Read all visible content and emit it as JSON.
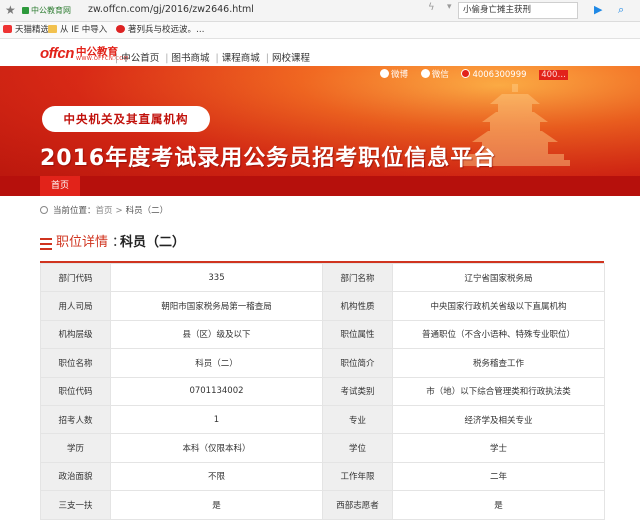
{
  "browser": {
    "site_tag": "中公教育网",
    "url": "zw.offcn.com/gj/2016/zw2646.html",
    "search_text": "小偷身亡摊主获刑"
  },
  "bookmarks": [
    {
      "label": "天猫精选",
      "icon": "tmall-icon"
    },
    {
      "label": "从 IE 中导入",
      "icon": "folder-icon"
    },
    {
      "label": "著列兵与校远波。…",
      "icon": "red-circle-icon"
    }
  ],
  "site": {
    "logo": "offcn",
    "logo_cn": "中公教育",
    "logo_sub": "WWW.OFFCN.COM",
    "nav": [
      "中公首页",
      "图书商城",
      "课程商城",
      "网校课程"
    ],
    "social": {
      "weibo": "微博",
      "weixin": "微信",
      "phone": "4006300999",
      "last": "400…"
    }
  },
  "banner": {
    "pill": "中央机关及其直属机构",
    "title": "2016年度考试录用公务员招考职位信息平台",
    "nav_home": "首页"
  },
  "breadcrumb": {
    "label": "当前位置：",
    "home": "首页",
    "current": "科员（二）"
  },
  "detail": {
    "label": "职位详情",
    "colon": "：",
    "value": "科员（二）"
  },
  "table": {
    "rows": [
      [
        "部门代码",
        "335",
        "部门名称",
        "辽宁省国家税务局"
      ],
      [
        "用人司局",
        "朝阳市国家税务局第一稽查局",
        "机构性质",
        "中央国家行政机关省级以下直属机构"
      ],
      [
        "机构层级",
        "县（区）级及以下",
        "职位属性",
        "普通职位（不含小语种、特殊专业职位）"
      ],
      [
        "职位名称",
        "科员（二）",
        "职位简介",
        "税务稽查工作"
      ],
      [
        "职位代码",
        "0701134002",
        "考试类别",
        "市（地）以下综合管理类和行政执法类"
      ],
      [
        "招考人数",
        "1",
        "专业",
        "经济学及相关专业"
      ],
      [
        "学历",
        "本科（仅限本科）",
        "学位",
        "学士"
      ],
      [
        "政治面貌",
        "不限",
        "工作年限",
        "二年"
      ],
      [
        "三支一扶",
        "是",
        "西部志愿者",
        "是"
      ]
    ]
  },
  "colors": {
    "brand_red": "#e2231a",
    "heading_red": "#d0341f",
    "banner_dark": "#b6100c",
    "key_cell_bg": "#efefef"
  }
}
